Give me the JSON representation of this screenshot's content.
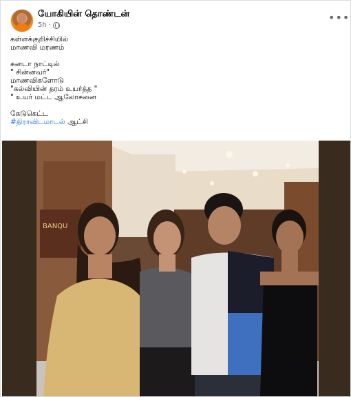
{
  "post": {
    "author": "யோகியின் தொண்டன்",
    "time": "5h",
    "more_label": "•••",
    "lines_block1": [
      "கள்ளக்குறிச்சியில்",
      "மாணவி மரணம்"
    ],
    "lines_block2": [
      "கனடா நாட்டில்",
      "\" சின்னவர்\"",
      "மாணவிகளோடு",
      "\"கல்வியின் தரம் உயர்த்த \"",
      "\" உயர் மட்ட ஆலோசனை"
    ],
    "line_block3_1": "கேடுகெட்ட",
    "hashtag": "#திராவிடமாடல்",
    "after_hashtag": " ஆட்சி",
    "photo_sign_text": "BANQU"
  },
  "colors": {
    "hashtag": "#216fdb",
    "meta": "#65676b"
  }
}
